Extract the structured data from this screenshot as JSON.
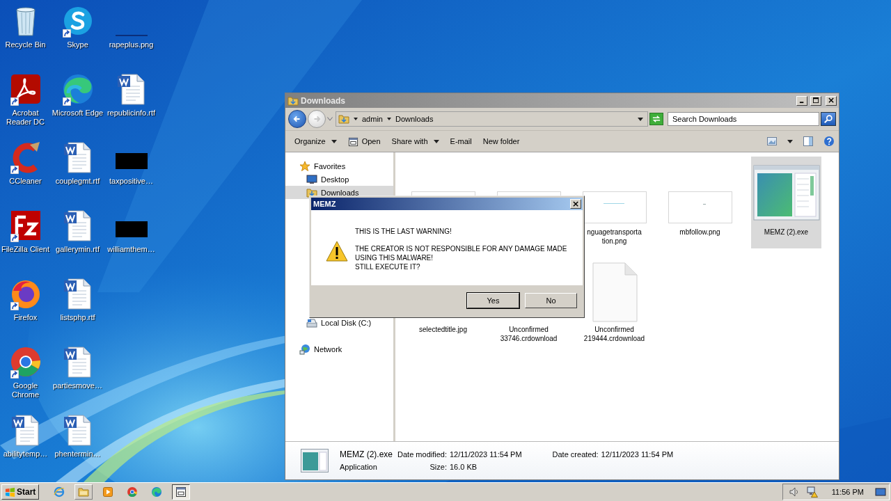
{
  "desktop_icons": [
    {
      "label": "Recycle Bin",
      "kind": "recycle-bin",
      "shortcut": false
    },
    {
      "label": "Acrobat Reader DC",
      "kind": "acrobat",
      "shortcut": true
    },
    {
      "label": "CCleaner",
      "kind": "ccleaner",
      "shortcut": true
    },
    {
      "label": "FileZilla Client",
      "kind": "filezilla",
      "shortcut": true
    },
    {
      "label": "Firefox",
      "kind": "firefox",
      "shortcut": true
    },
    {
      "label": "Google Chrome",
      "kind": "chrome",
      "shortcut": true
    },
    {
      "label": "abilitytemp…",
      "kind": "word",
      "shortcut": false
    },
    {
      "label": "Skype",
      "kind": "skype",
      "shortcut": true
    },
    {
      "label": "Microsoft Edge",
      "kind": "edge",
      "shortcut": true
    },
    {
      "label": "couplegmt.rtf",
      "kind": "word",
      "shortcut": false
    },
    {
      "label": "gallerymin.rtf",
      "kind": "word",
      "shortcut": false
    },
    {
      "label": "listsphp.rtf",
      "kind": "word",
      "shortcut": false
    },
    {
      "label": "partiesmove…",
      "kind": "word",
      "shortcut": false
    },
    {
      "label": "phentermin…",
      "kind": "word",
      "shortcut": false
    },
    {
      "label": "rapeplus.png",
      "kind": "image-faint",
      "shortcut": false
    },
    {
      "label": "republicinfo.rtf",
      "kind": "word",
      "shortcut": false
    },
    {
      "label": "taxpositive…",
      "kind": "image-black",
      "shortcut": false
    },
    {
      "label": "williamthem…",
      "kind": "image-black",
      "shortcut": false
    }
  ],
  "explorer": {
    "title": "Downloads",
    "nav_buttons": [
      {
        "kind": "back",
        "disabled": false
      },
      {
        "kind": "forward",
        "disabled": true
      }
    ],
    "path": [
      "admin",
      "Downloads"
    ],
    "search": {
      "placeholder": "Search Downloads"
    },
    "commands": [
      {
        "label": "Organize",
        "kind": "menu"
      },
      {
        "label": "Open",
        "kind": "open"
      },
      {
        "label": "Share with",
        "kind": "menu"
      },
      {
        "label": "E-mail",
        "kind": "plain"
      },
      {
        "label": "New folder",
        "kind": "plain"
      }
    ],
    "navigation": [
      {
        "label": "Favorites",
        "kind": "star",
        "children": [
          {
            "label": "Desktop",
            "kind": "desktop",
            "selected": false
          },
          {
            "label": "Downloads",
            "kind": "download-folder",
            "selected": true
          }
        ]
      },
      {
        "label": "Local Disk (C:)",
        "kind": "drive"
      },
      {
        "label": "Network",
        "kind": "network"
      }
    ],
    "files": [
      {
        "kind": "thumb-blank",
        "selected": false
      },
      {
        "kind": "thumb-blank",
        "selected": false
      },
      {
        "kind": "thumb-line",
        "label": [
          "nguagetransporta",
          "tion.png"
        ],
        "selected": false
      },
      {
        "kind": "thumb-dot",
        "label": [
          "mbfollow.png"
        ],
        "selected": false
      },
      {
        "kind": "app",
        "label": [
          "MEMZ (2).exe"
        ],
        "selected": true
      },
      {
        "kind": "none",
        "label": [
          "selectedtitle.jpg"
        ],
        "selected": false
      },
      {
        "kind": "none",
        "label": [
          "Unconfirmed",
          "33746.crdownload"
        ],
        "selected": false
      },
      {
        "kind": "file",
        "label": [
          "Unconfirmed",
          "219444.crdownload"
        ],
        "selected": false
      }
    ],
    "details": {
      "name": "MEMZ (2).exe",
      "type": "Application",
      "fields": [
        {
          "label": "Date modified:",
          "value": "12/11/2023 11:54 PM"
        },
        {
          "label": "Size:",
          "value": "16.0 KB"
        },
        {
          "label": "Date created:",
          "value": "12/11/2023 11:54 PM"
        }
      ]
    }
  },
  "dialog": {
    "title": "MEMZ",
    "paragraphs": [
      [
        "THIS IS THE LAST WARNING!"
      ],
      [
        "THE CREATOR IS NOT RESPONSIBLE FOR ANY DAMAGE MADE",
        "USING THIS MALWARE!",
        "STILL EXECUTE IT?"
      ]
    ],
    "buttons": [
      {
        "label": "Yes",
        "selected": true
      },
      {
        "label": "No",
        "selected": false
      }
    ]
  },
  "taskbar": {
    "start": "Start",
    "items": [
      {
        "kind": "ie",
        "selected": false
      },
      {
        "kind": "folder",
        "selected": true
      },
      {
        "kind": "media",
        "selected": false
      },
      {
        "kind": "chrome",
        "selected": false
      },
      {
        "kind": "edge",
        "selected": false
      },
      {
        "kind": "app-window",
        "selected": true
      }
    ],
    "clock": "11:56 PM"
  }
}
